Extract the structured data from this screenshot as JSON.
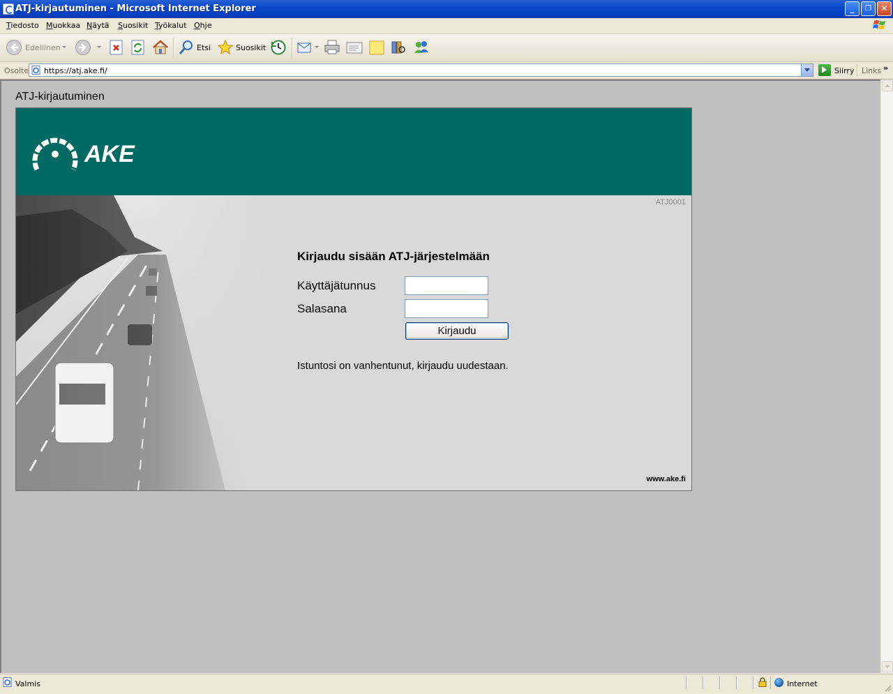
{
  "window": {
    "title": "ATJ-kirjautuminen - Microsoft Internet Explorer",
    "minimize": "_",
    "restore": "❐",
    "close": "✕"
  },
  "menu": [
    "Tiedosto",
    "Muokkaa",
    "Näytä",
    "Suosikit",
    "Työkalut",
    "Ohje"
  ],
  "toolbar": {
    "back_label": "Edellinen",
    "search_label": "Etsi",
    "favorites_label": "Suosikit"
  },
  "address": {
    "label": "Osoite",
    "url": "https://atj.ake.fi/",
    "go_label": "Siirry",
    "links_label": "Links",
    "links_chevron": "»"
  },
  "page": {
    "heading": "ATJ-kirjautuminen",
    "logo_text": "AKE",
    "screen_code": "ATJ0001",
    "form_title": "Kirjaudu sisään ATJ-järjestelmään",
    "username_label": "Käyttäjätunnus",
    "username_value": "",
    "password_label": "Salasana",
    "password_value": "",
    "login_button": "Kirjaudu",
    "session_message": "Istuntosi on vanhentunut, kirjaudu uudestaan.",
    "footer_url": "www.ake.fi",
    "colors": {
      "banner": "#006a63",
      "panel": "#d9d9d9",
      "viewport": "#c0c0c0"
    }
  },
  "status": {
    "text": "Valmis",
    "zone": "Internet"
  }
}
